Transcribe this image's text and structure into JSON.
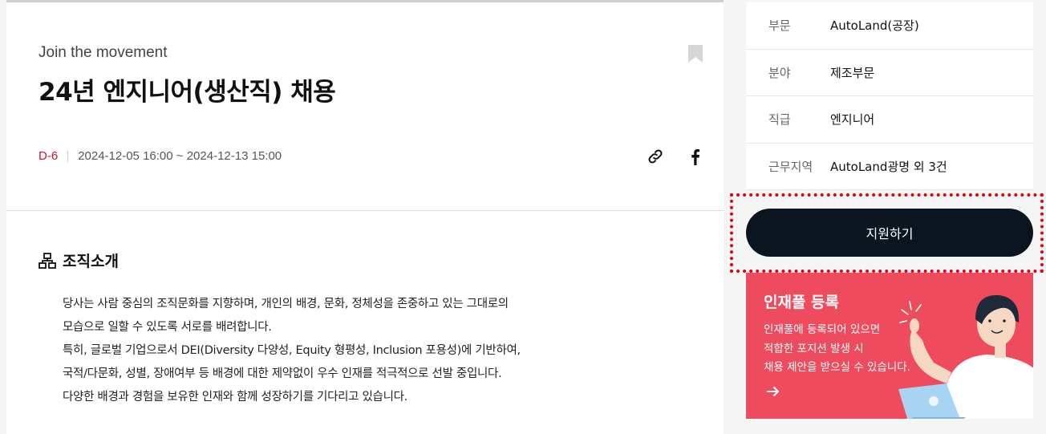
{
  "job": {
    "subtitle": "Join the movement",
    "title": "24년 엔지니어(생산직) 채용",
    "dday": "D-6",
    "period": "2024-12-05 16:00 ~ 2024-12-13 15:00"
  },
  "icons": {
    "bookmark": "bookmark-icon",
    "link": "link-icon",
    "facebook": "facebook-icon",
    "org": "org-chart-icon",
    "arrow": "arrow-right-icon"
  },
  "section": {
    "title": "조직소개",
    "lines": [
      "당사는 사람 중심의 조직문화를 지향하며, 개인의 배경, 문화, 정체성을 존중하고 있는 그대로의",
      "모습으로 일할 수 있도록 서로를 배려합니다.",
      "특히, 글로벌 기업으로서 DEI(Diversity 다양성, Equity 형평성, Inclusion 포용성)에 기반하여,",
      "국적/다문화, 성별, 장애여부 등 배경에 대한 제약없이 우수 인재를 적극적으로 선발 중입니다.",
      "다양한 배경과 경험을 보유한 인재와 함께 성장하기를 기다리고 있습니다."
    ]
  },
  "sidebar": {
    "info": [
      {
        "label": "부문",
        "value": "AutoLand(공장)"
      },
      {
        "label": "분야",
        "value": "제조부문"
      },
      {
        "label": "직급",
        "value": "엔지니어"
      },
      {
        "label": "근무지역",
        "value": "AutoLand광명 외 3건"
      }
    ],
    "apply_label": "지원하기",
    "talent": {
      "title": "인재풀 등록",
      "desc": [
        "인재풀에 등록되어 있으면",
        "적합한 포지션 발생 시",
        "채용 제안을 받으실 수 있습니다."
      ]
    }
  },
  "colors": {
    "dday": "#d0103a",
    "apply_button": "#0a1520",
    "talent_bg": "#ef4b5e",
    "highlight": "#e60012"
  }
}
